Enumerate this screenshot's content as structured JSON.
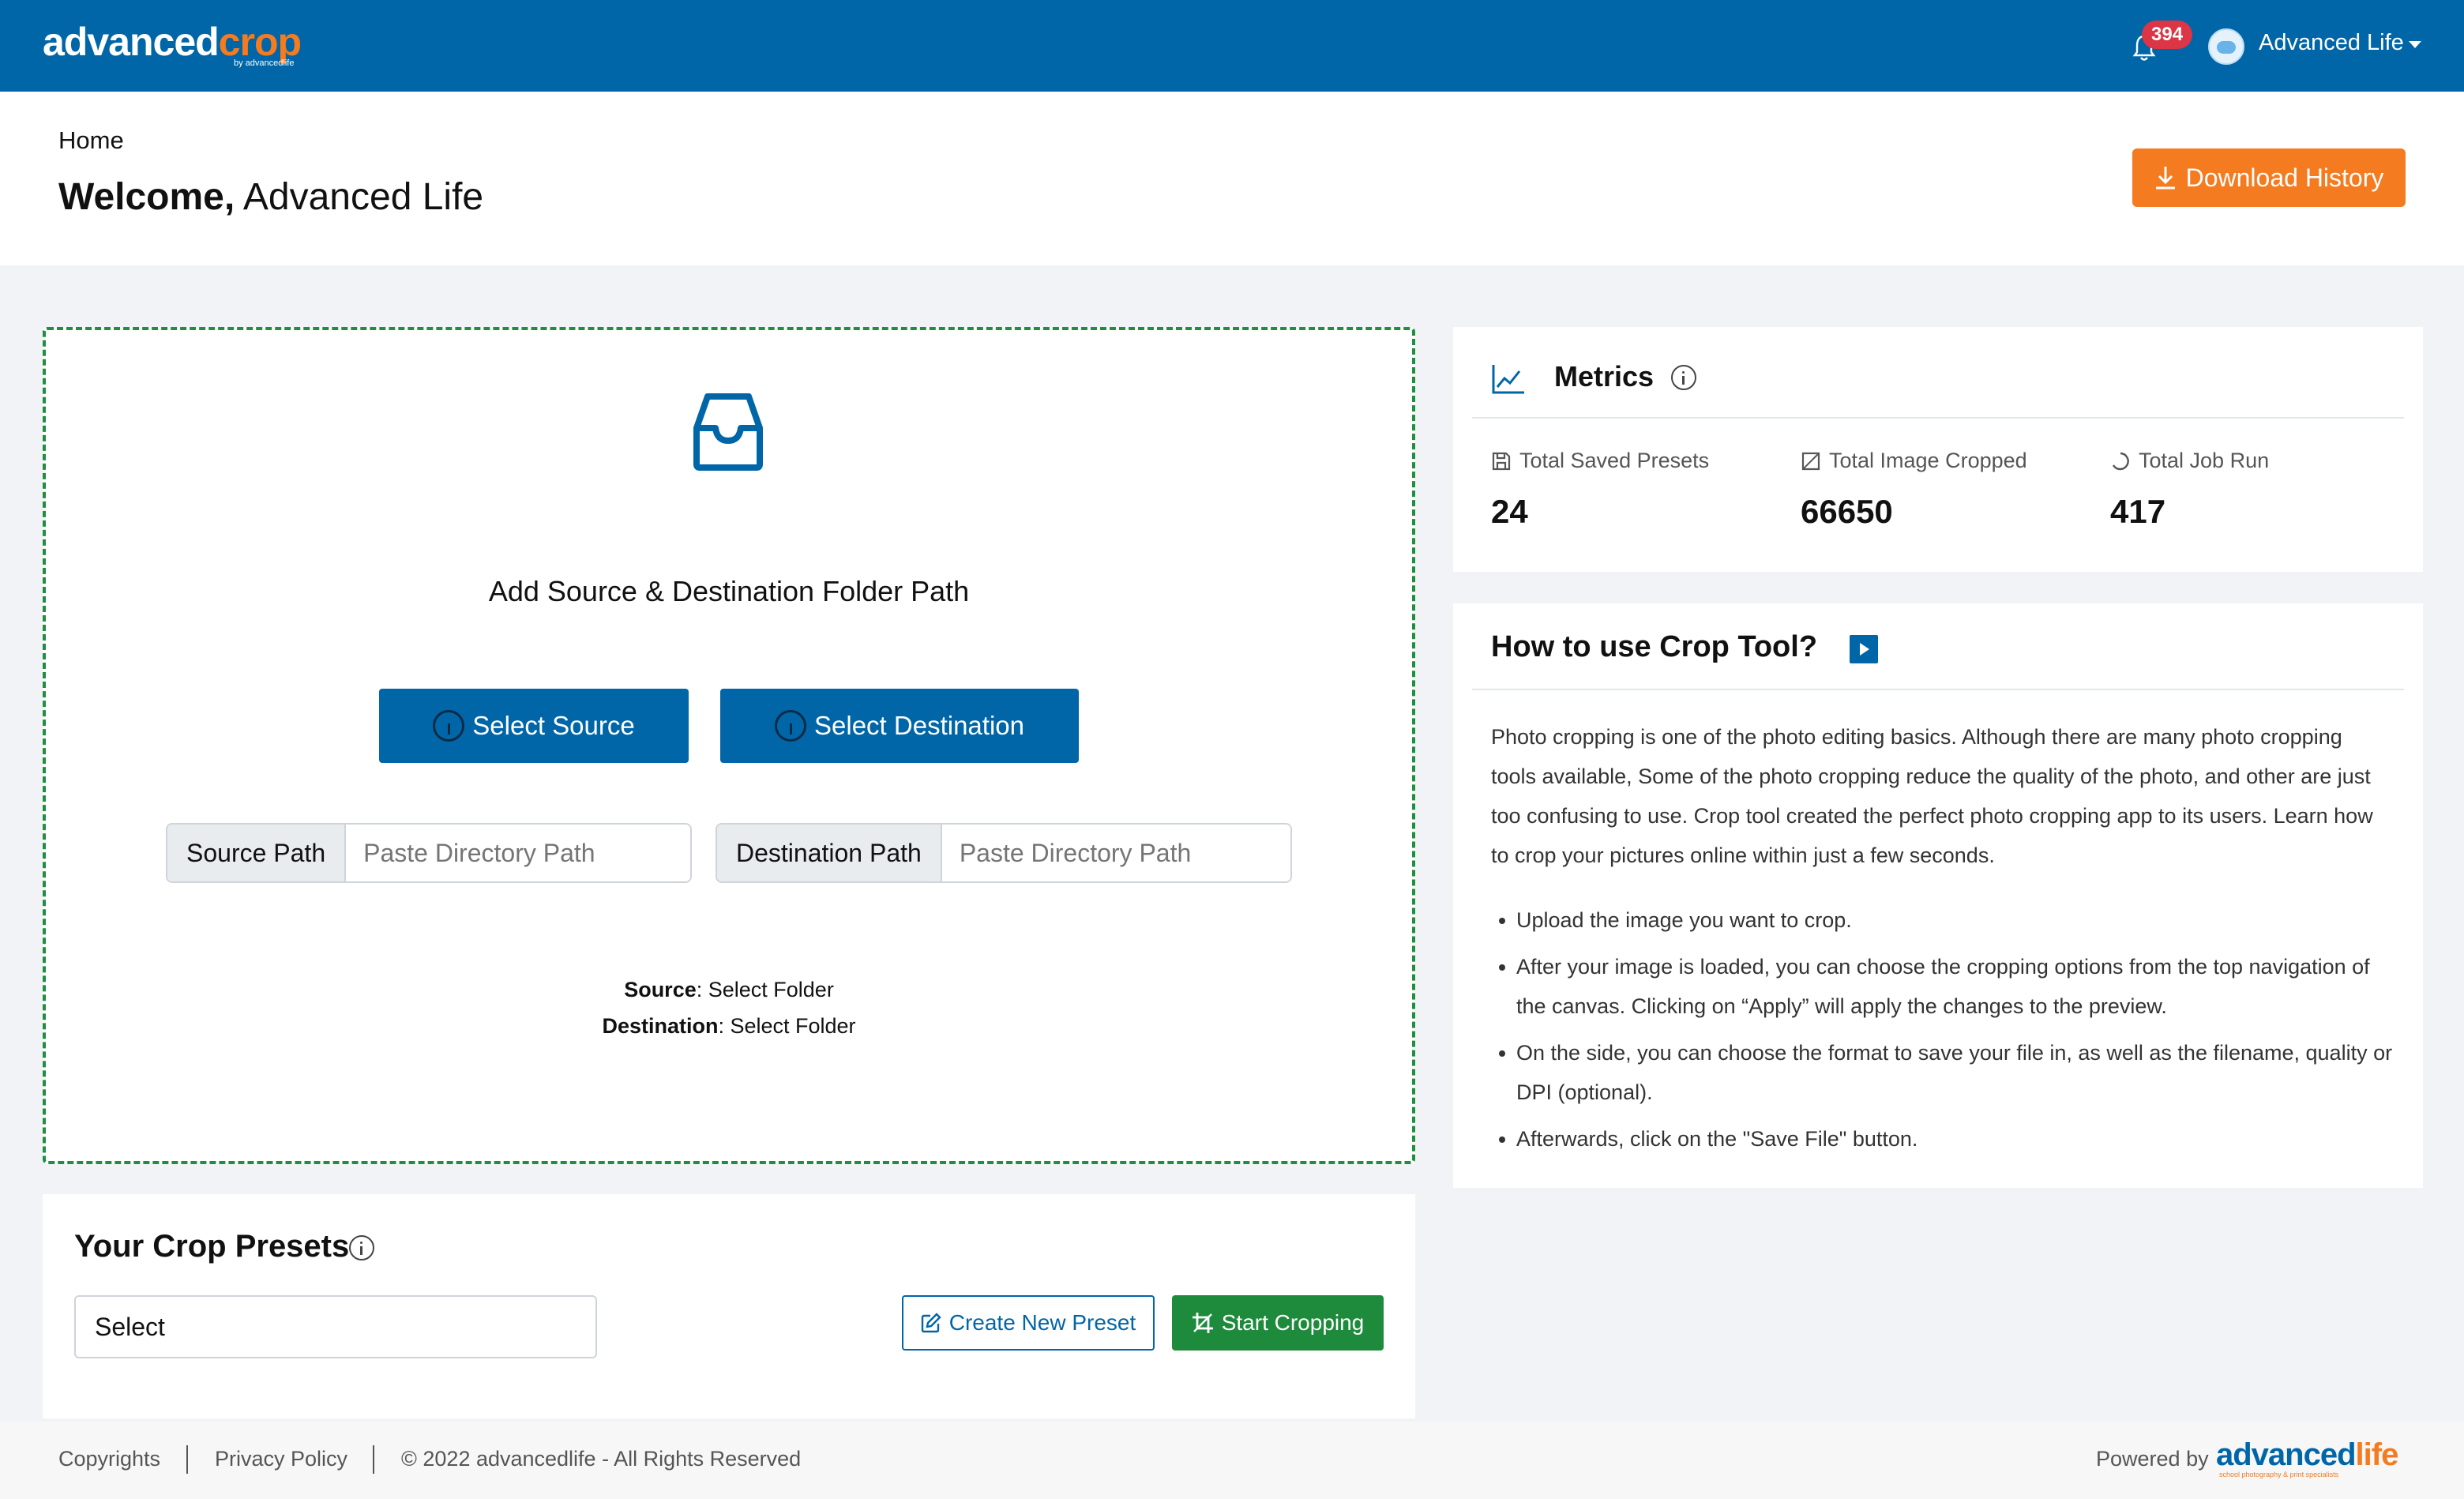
{
  "topbar": {
    "logo_main": "advanced",
    "logo_accent": "crop",
    "logo_sub": "by advancedlife",
    "notification_count": "394",
    "user_name": "Advanced Life"
  },
  "header": {
    "breadcrumb": "Home",
    "welcome_bold": "Welcome,",
    "welcome_name": "Advanced Life",
    "download_label": "Download History"
  },
  "dropzone": {
    "title": "Add Source & Destination Folder Path",
    "select_source_label": "Select Source",
    "select_destination_label": "Select Destination",
    "source_path_label": "Source Path",
    "source_path_placeholder": "Paste Directory Path",
    "destination_path_label": "Destination Path",
    "destination_path_placeholder": "Paste Directory Path",
    "source_summary_label": "Source",
    "source_summary_value": ": Select Folder",
    "destination_summary_label": "Destination",
    "destination_summary_value": ": Select Folder"
  },
  "presets": {
    "title": "Your Crop Presets",
    "select_value": "Select",
    "create_label": "Create New Preset",
    "start_label": "Start Cropping"
  },
  "metrics": {
    "title": "Metrics",
    "items": [
      {
        "label": "Total Saved Presets",
        "value": "24",
        "icon": "save-icon"
      },
      {
        "label": "Total Image Cropped",
        "value": "66650",
        "icon": "image-icon"
      },
      {
        "label": "Total Job Run",
        "value": "417",
        "icon": "spinner-icon"
      }
    ]
  },
  "howto": {
    "title": "How to use Crop Tool?",
    "paragraph": "Photo cropping is one of the photo editing basics. Although there are many photo cropping tools available, Some of the photo cropping reduce the quality of the photo, and other are just too confusing to use. Crop tool created the perfect photo cropping app to its users. Learn how to crop your pictures online within just a few seconds.",
    "steps": [
      "Upload the image you want to crop.",
      "After your image is loaded, you can choose the cropping options from the top navigation of the canvas. Clicking on “Apply” will apply the changes to the preview.",
      "On the side, you can choose the format to save your file in, as well as the filename, quality or DPI (optional).",
      "Afterwards, click on the \"Save File\" button."
    ]
  },
  "footer": {
    "copyrights": "Copyrights",
    "privacy": "Privacy Policy",
    "rights": "© 2022 advancedlife - All Rights Reserved",
    "powered_by": "Powered by",
    "brand_main": "advanced",
    "brand_accent": "life",
    "brand_sub": "school photography & print specialists"
  },
  "colors": {
    "primary": "#0066a8",
    "accent": "#f47b20",
    "success": "#1e8a3c",
    "danger": "#dc3545"
  }
}
